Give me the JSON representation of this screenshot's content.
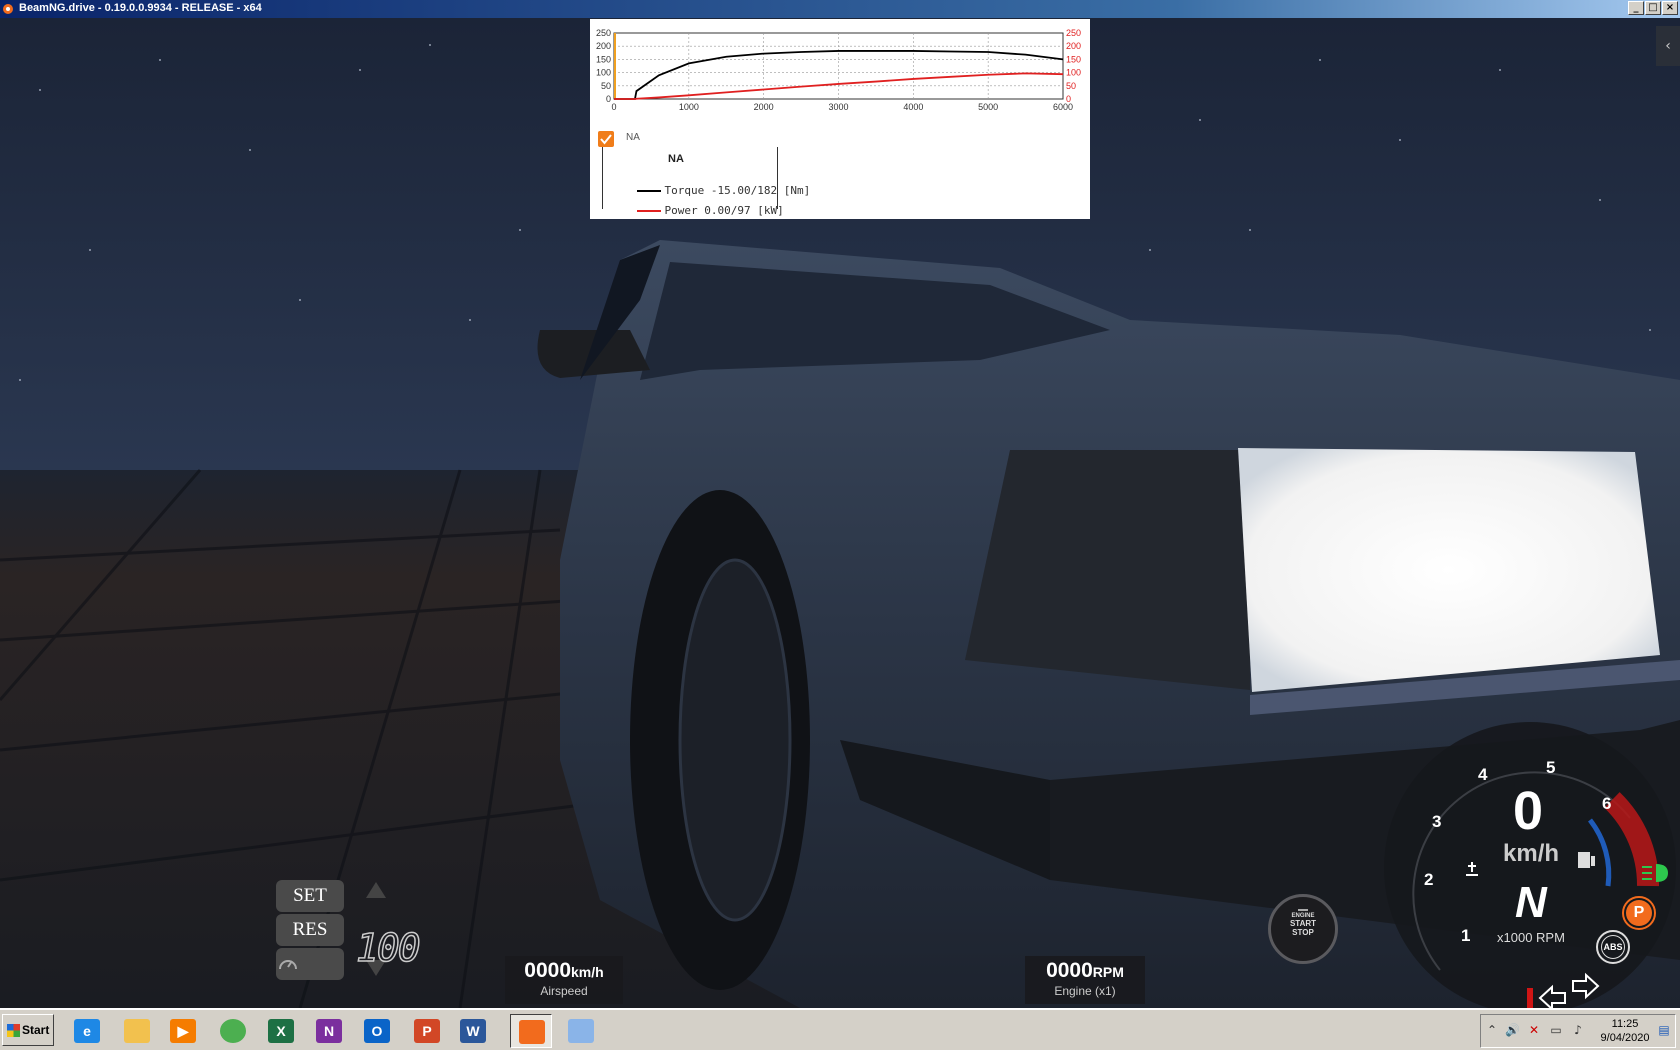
{
  "window": {
    "title": "BeamNG.drive - 0.19.0.0.9934 - RELEASE - x64",
    "minimize_label": "_",
    "maximize_label": "□",
    "close_label": "×"
  },
  "graph": {
    "checkbox_checked": true,
    "checkbox_label": "NA",
    "legend_title": "NA",
    "legend_rows": [
      {
        "name": "Torque",
        "value": "-15.00/182",
        "unit": "[Nm]",
        "color": "#000000"
      },
      {
        "name": "Power",
        "value": "0.00/97",
        "unit": "[kW]",
        "color": "#e02020"
      }
    ]
  },
  "chart_data": {
    "type": "line",
    "x": [
      0,
      280,
      300,
      600,
      1000,
      1500,
      2000,
      2500,
      3000,
      3500,
      4000,
      4500,
      5000,
      5500,
      6000
    ],
    "series": [
      {
        "name": "Torque",
        "axis": "left",
        "color": "#000000",
        "values": [
          0,
          0,
          30,
          90,
          135,
          160,
          172,
          178,
          182,
          182,
          182,
          180,
          178,
          168,
          150
        ]
      },
      {
        "name": "Power",
        "axis": "right",
        "color": "#e02020",
        "values": [
          0,
          0,
          1,
          6,
          14,
          25,
          36,
          47,
          57,
          66,
          76,
          84,
          92,
          97,
          94
        ]
      }
    ],
    "xlim": [
      0,
      6000
    ],
    "ylim": [
      0,
      250
    ],
    "y2lim": [
      0,
      250
    ],
    "x_ticks": [
      "0",
      "1000",
      "2000",
      "3000",
      "4000",
      "5000",
      "6000"
    ],
    "y_ticks": [
      "0",
      "50",
      "100",
      "150",
      "200",
      "250"
    ],
    "y2_ticks": [
      "0",
      "50",
      "100",
      "150",
      "200",
      "250"
    ],
    "grid": true
  },
  "cruise": {
    "set_label": "SET",
    "res_label": "RES",
    "speed_value": "100"
  },
  "airspeed": {
    "value": "0000",
    "unit": "km/h",
    "label": "Airspeed"
  },
  "engine": {
    "value": "0000",
    "unit": "RPM",
    "label": "Engine (x1)"
  },
  "start_stop": {
    "line1": "ENGINE",
    "line2": "START",
    "line3": "STOP"
  },
  "gauge": {
    "speed": "0",
    "speed_unit": "km/h",
    "gear": "N",
    "rpm_label": "x1000 RPM",
    "rpm_ticks": [
      "1",
      "2",
      "3",
      "4",
      "5",
      "6"
    ],
    "abs_label": "ABS",
    "park_label": "P"
  },
  "taskbar": {
    "start_label": "Start",
    "apps": [
      {
        "name": "internet-explorer",
        "glyph": "e",
        "color": "#1e88e5"
      },
      {
        "name": "file-explorer",
        "glyph": "",
        "color": "#f2c14e"
      },
      {
        "name": "media-player",
        "glyph": "▶",
        "color": "#f57c00"
      },
      {
        "name": "chrome",
        "glyph": "",
        "color": "#4caf50"
      },
      {
        "name": "excel",
        "glyph": "X",
        "color": "#1d7044"
      },
      {
        "name": "onenote",
        "glyph": "N",
        "color": "#7b2f9e"
      },
      {
        "name": "outlook",
        "glyph": "O",
        "color": "#0a64c8"
      },
      {
        "name": "powerpoint",
        "glyph": "P",
        "color": "#d24726"
      },
      {
        "name": "word",
        "glyph": "W",
        "color": "#2b579a"
      },
      {
        "name": "beamng",
        "glyph": "",
        "color": "#f26b1d"
      },
      {
        "name": "paint",
        "glyph": "",
        "color": "#8ab4e8"
      }
    ],
    "clock_time": "11:25",
    "clock_date": "9/04/2020"
  }
}
